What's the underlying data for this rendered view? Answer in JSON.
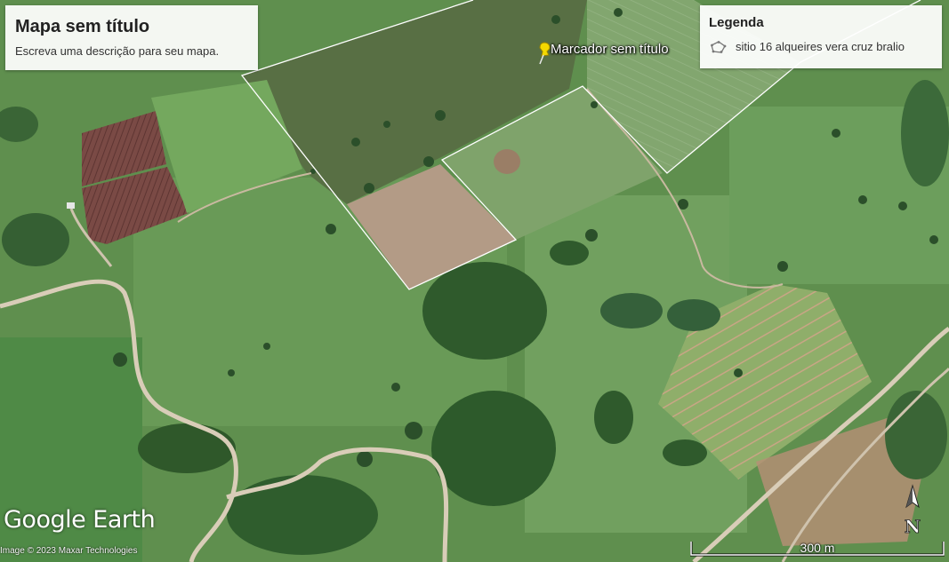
{
  "map": {
    "title": "Mapa sem título",
    "description": "Escreva uma descrição para seu mapa.",
    "provider_logo": "Google Earth",
    "attribution": "Image © 2023 Maxar Technologies"
  },
  "legend": {
    "title": "Legenda",
    "items": [
      {
        "label": "sitio 16 alqueires vera cruz bralio",
        "icon": "polygon-icon"
      }
    ]
  },
  "placemark": {
    "label": "Marcador sem título",
    "icon": "yellow-pushpin-icon",
    "color": "#f5d800"
  },
  "scale_bar": {
    "label": "300 m"
  },
  "compass": {
    "label": "N",
    "icon": "north-arrow-icon"
  },
  "colors": {
    "boundary_outline": "#ffffff",
    "pasture_green": "#6ea35a",
    "forest_dark": "#2f5a2c",
    "bare_soil": "#b8967a",
    "road": "#d9cdb8"
  }
}
